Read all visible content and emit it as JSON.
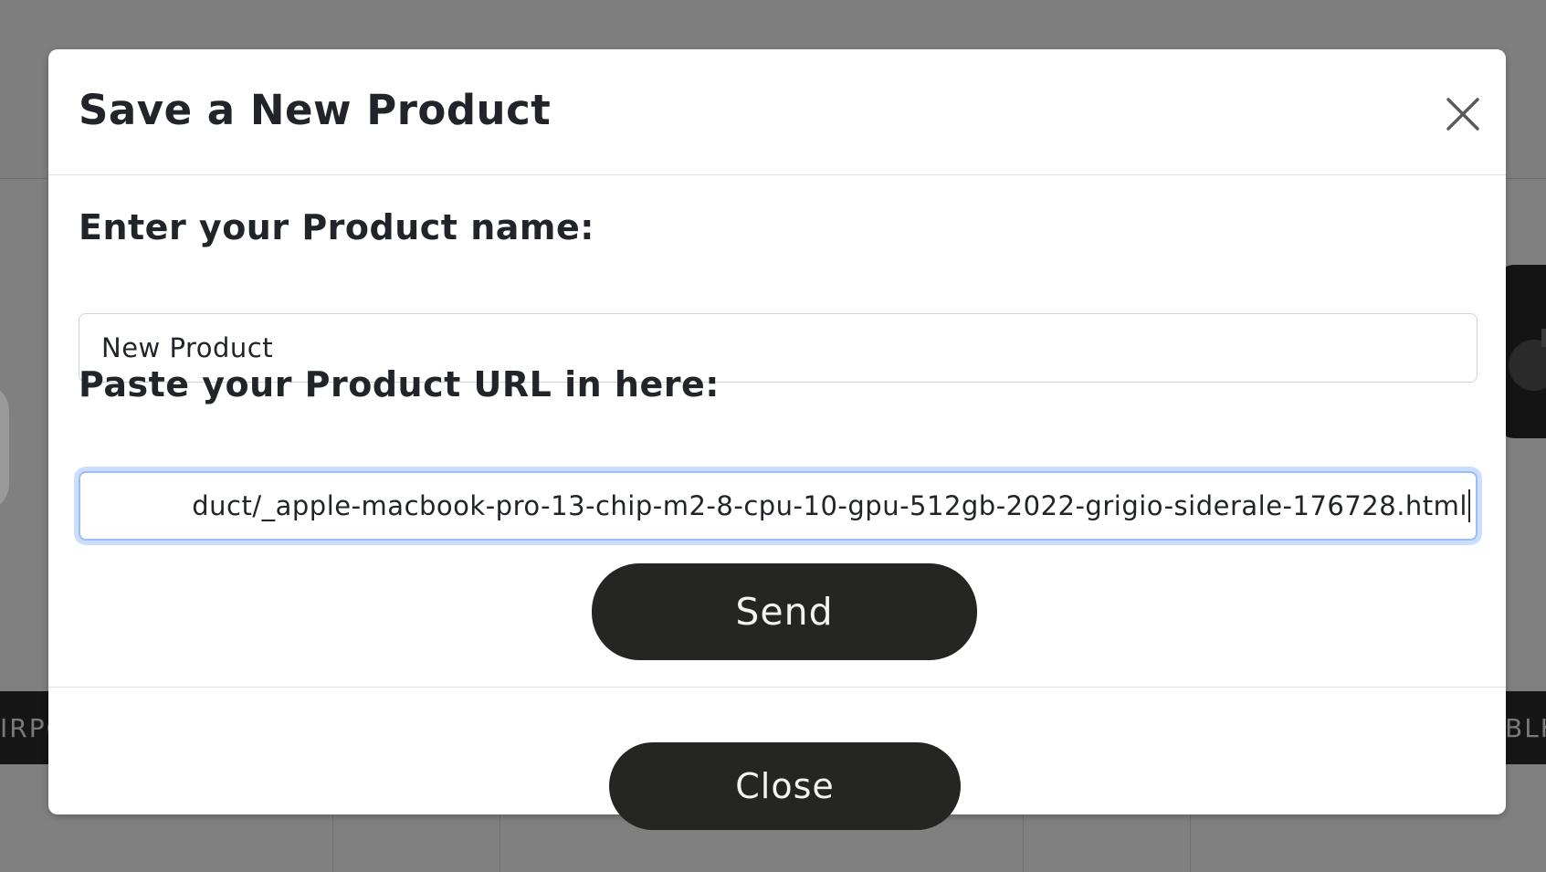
{
  "modal": {
    "title": "Save a New Product",
    "close_icon": "close-icon",
    "name_label": "Enter your Product name:",
    "name_value": "New Product",
    "url_label": "Paste your Product URL in here:",
    "url_value": "duct/_apple-macbook-pro-13-chip-m2-8-cpu-10-gpu-512gb-2022-grigio-siderale-176728.html",
    "send_label": "Send",
    "close_label": "Close"
  },
  "background": {
    "left_band_text": "IRPO",
    "right_band_text": "BLK",
    "left_image_icon": "headphones-image",
    "right_image_icon": "camera-image"
  },
  "colors": {
    "overlay": "#808080",
    "button_bg": "#252523",
    "button_text": "#f2f2f2",
    "focus_ring": "#9dbcf6",
    "text": "#212529"
  }
}
